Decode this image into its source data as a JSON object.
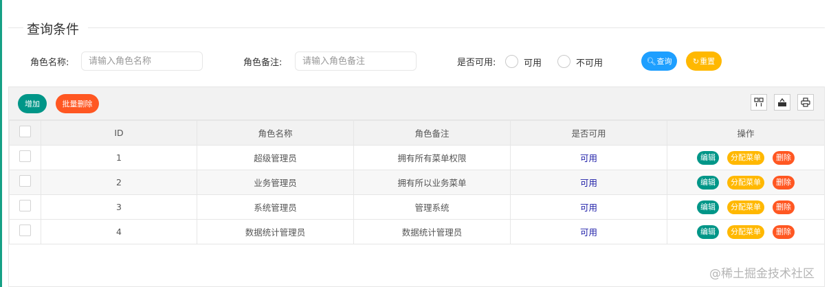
{
  "query": {
    "title": "查询条件",
    "role_name_label": "角色名称:",
    "role_name_placeholder": "请输入角色名称",
    "role_remark_label": "角色备注:",
    "role_remark_placeholder": "请输入角色备注",
    "available_label": "是否可用:",
    "radio_available": "可用",
    "radio_unavailable": "不可用",
    "search_label": "查询",
    "reset_label": "重置"
  },
  "toolbar": {
    "add_label": "增加",
    "batch_delete_label": "批量删除",
    "icons": [
      "columns-icon",
      "export-icon",
      "print-icon"
    ]
  },
  "table": {
    "headers": [
      "ID",
      "角色名称",
      "角色备注",
      "是否可用",
      "操作"
    ],
    "rows": [
      {
        "id": "1",
        "name": "超级管理员",
        "remark": "拥有所有菜单权限",
        "status": "可用"
      },
      {
        "id": "2",
        "name": "业务管理员",
        "remark": "拥有所以业务菜单",
        "status": "可用"
      },
      {
        "id": "3",
        "name": "系统管理员",
        "remark": "管理系统",
        "status": "可用"
      },
      {
        "id": "4",
        "name": "数据统计管理员",
        "remark": "数据统计管理员",
        "status": "可用"
      }
    ],
    "actions": {
      "edit": "编辑",
      "assign_menu": "分配菜单",
      "delete": "删除"
    }
  },
  "colors": {
    "accent_green": "#009688",
    "blue": "#1e9fff",
    "orange": "#ffb800",
    "red": "#ff5722"
  },
  "watermark": "@稀土掘金技术社区"
}
